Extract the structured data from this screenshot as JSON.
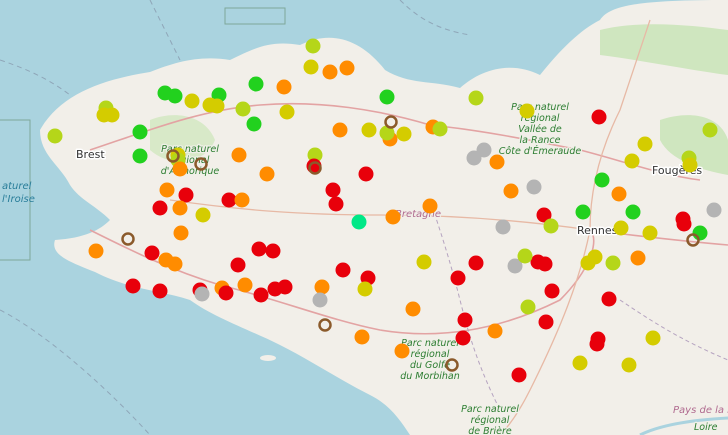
{
  "labels": {
    "brest": "Brest",
    "rennes": "Rennes",
    "fougeres": "Fougères",
    "bretagne": "Bretagne",
    "pays_de_la_loire": "Pays de la Loire",
    "sea_iroise_1": "aturel",
    "sea_iroise_2": "l'Iroise",
    "park_armorique": [
      "Parc naturel",
      "régional",
      "d'Armorique"
    ],
    "park_rance": [
      "Parc naturel",
      "régional",
      "Vallée de",
      "la Rance",
      "Côte d'Émeraude"
    ],
    "park_morbihan": [
      "Parc naturel",
      "régional",
      "du Golfe",
      "du Morbihan"
    ],
    "park_briere": [
      "Parc naturel",
      "régional",
      "de Brière"
    ],
    "loire": "Loire"
  },
  "colors": {
    "sea": "#aad3df",
    "land": "#f2efe9",
    "red": "#e8000b",
    "orange": "#ff8c00",
    "yellow": "#d4cc00",
    "lime": "#b5d619",
    "green": "#22d11e",
    "gray": "#b4b4b4",
    "aqua": "#00e887",
    "ring": "#8b5a2b"
  }
}
